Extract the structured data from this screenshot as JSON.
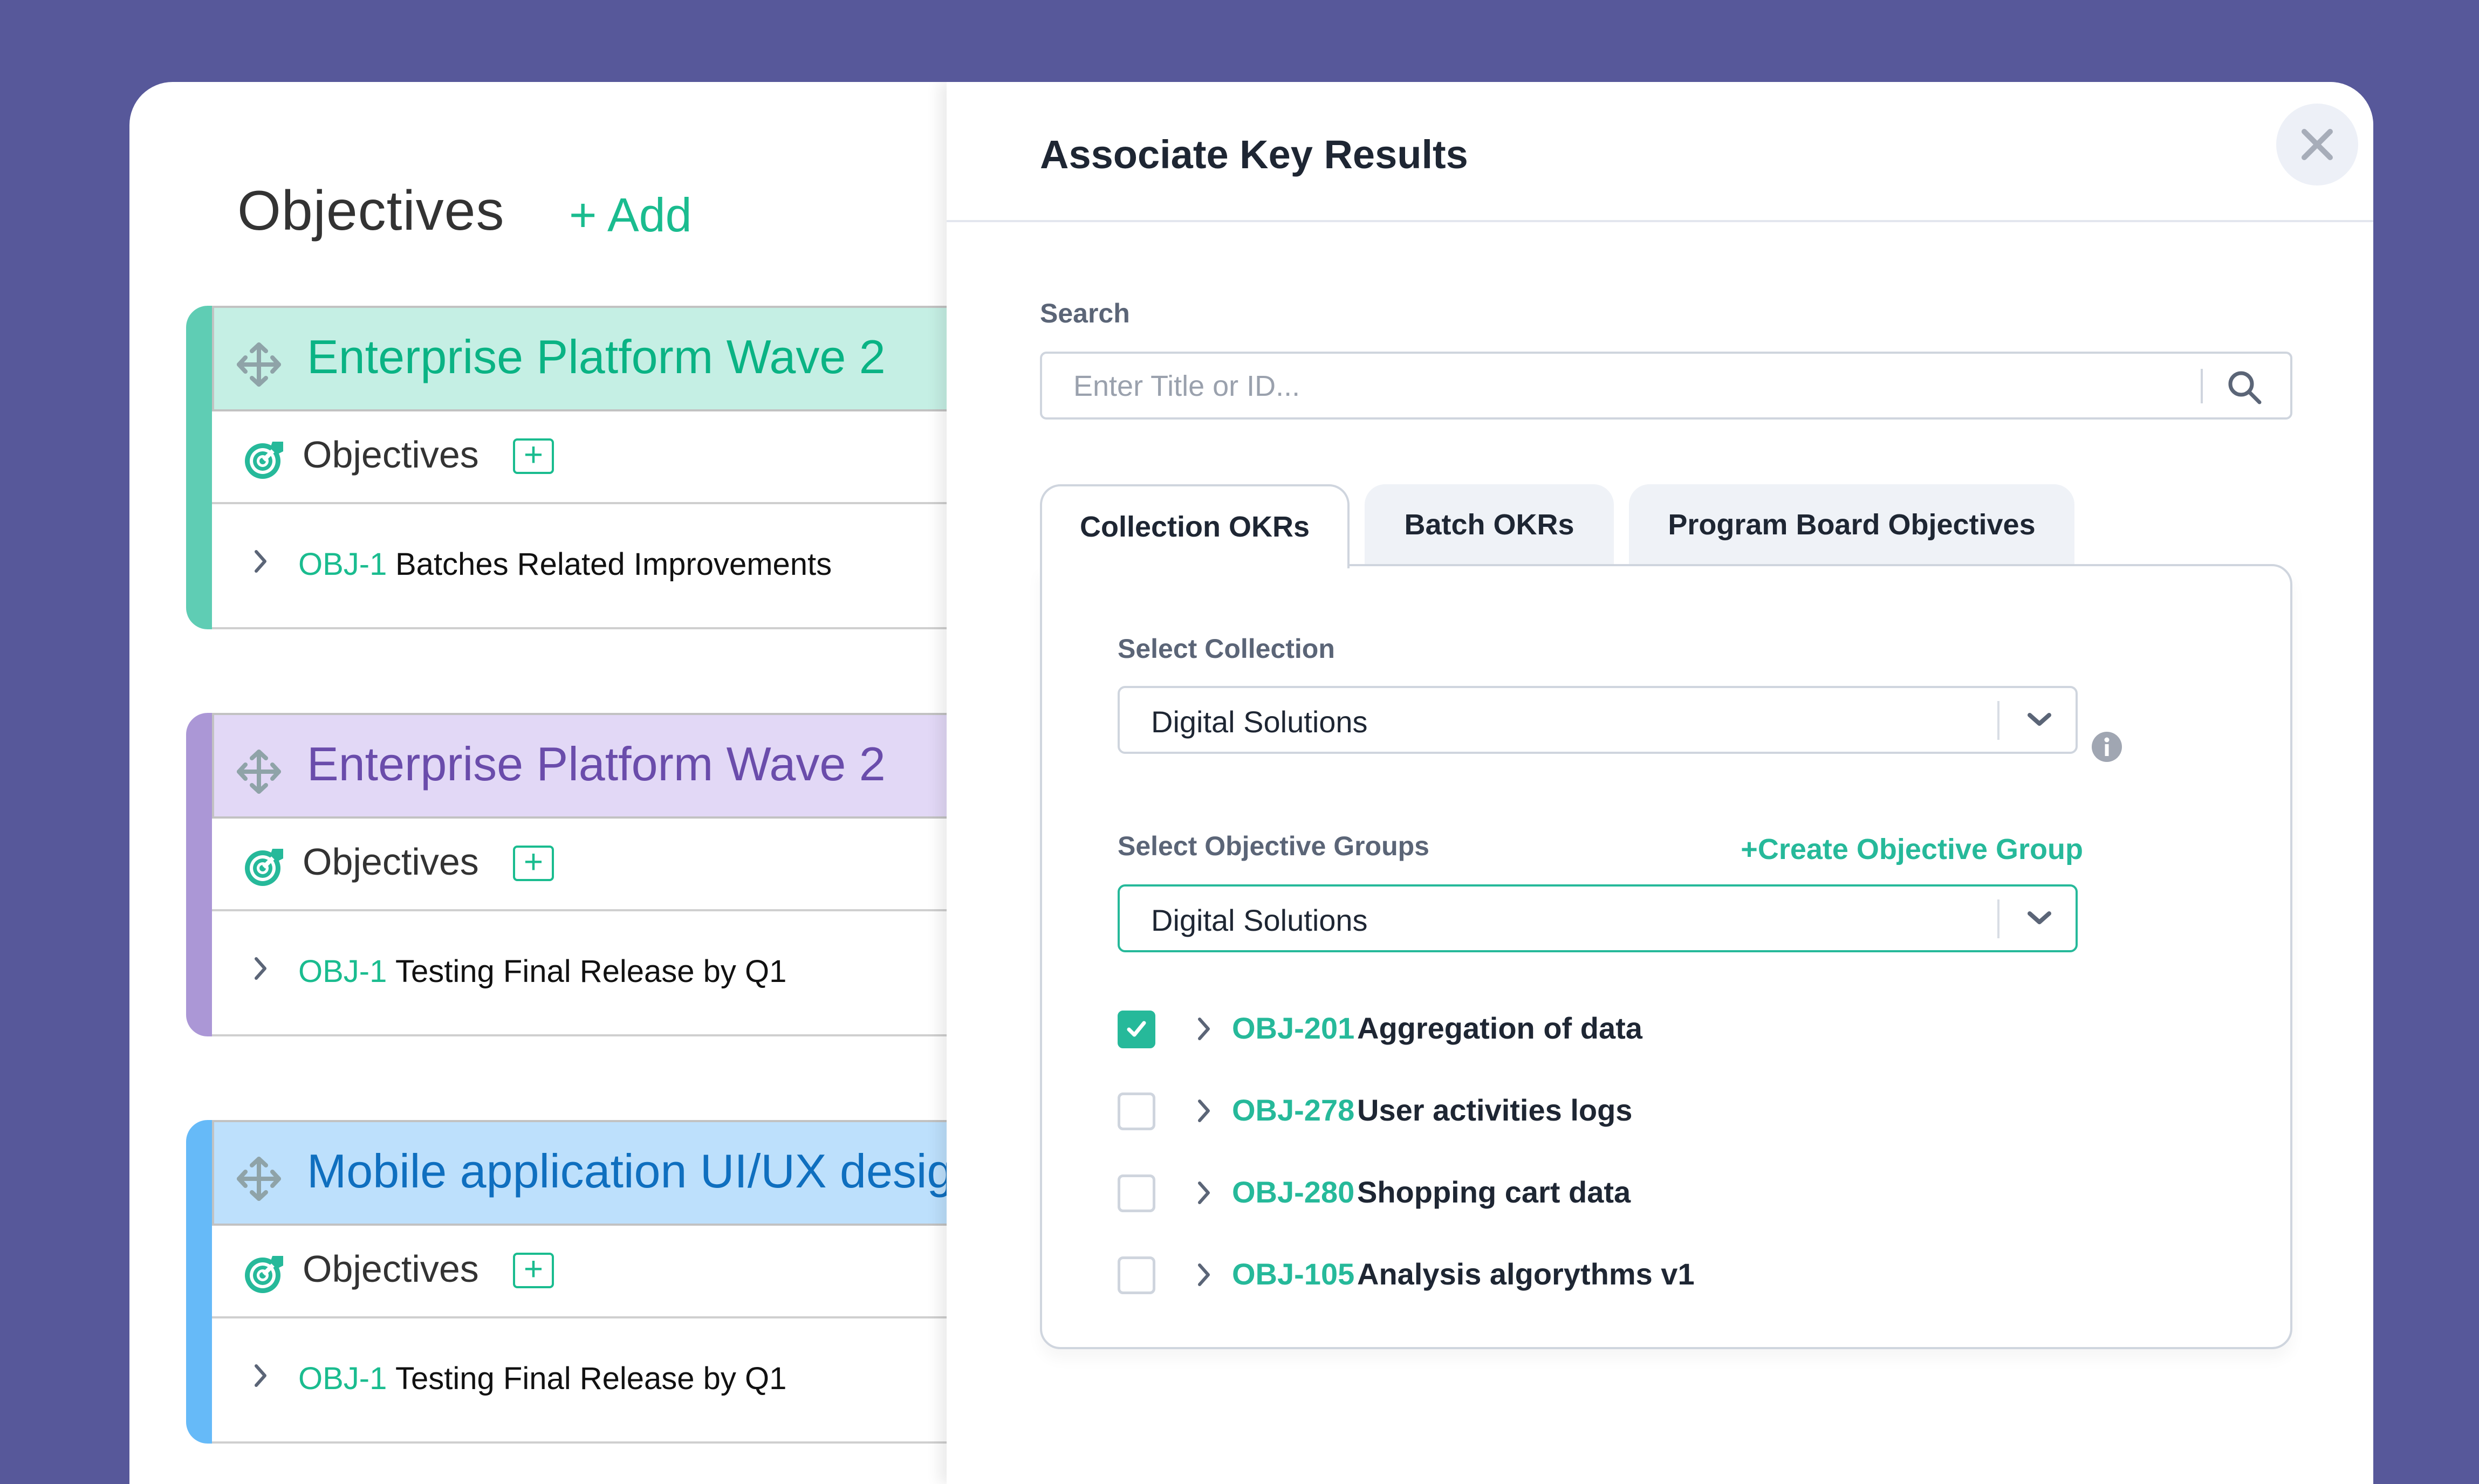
{
  "left": {
    "title": "Objectives",
    "add_label": "+ Add",
    "groups": [
      {
        "title": "Enterprise Platform Wave 2",
        "bar_color": "#5fcdb4",
        "head_bg": "#c5efe4",
        "title_color": "#0ab384",
        "section_label": "Objectives",
        "add_icon": "+",
        "item": {
          "id": "OBJ-1",
          "title": "Batches Related Improvements"
        }
      },
      {
        "title": "Enterprise Platform Wave 2",
        "bar_color": "#ab97d6",
        "head_bg": "#e2d8f6",
        "title_color": "#6a4cab",
        "section_label": "Objectives",
        "add_icon": "+",
        "item": {
          "id": "OBJ-1",
          "title": "Testing Final Release by Q1"
        }
      },
      {
        "title": "Mobile application UI/UX design",
        "bar_color": "#66baf8",
        "head_bg": "#bde0fc",
        "title_color": "#0f6fbf",
        "section_label": "Objectives",
        "add_icon": "+",
        "item": {
          "id": "OBJ-1",
          "title": "Testing Final Release by Q1"
        }
      }
    ]
  },
  "panel": {
    "title": "Associate Key Results",
    "close_icon": "close-icon",
    "search": {
      "label": "Search",
      "placeholder": "Enter Title or ID...",
      "value": ""
    },
    "tabs": [
      {
        "label": "Collection OKRs",
        "active": true
      },
      {
        "label": "Batch OKRs",
        "active": false
      },
      {
        "label": "Program Board Objectives",
        "active": false
      }
    ],
    "collection": {
      "label": "Select Collection",
      "value": "Digital Solutions"
    },
    "objective_groups": {
      "label": "Select Objective Groups",
      "create_label": "+Create Objective Group",
      "value": "Digital Solutions"
    },
    "results": [
      {
        "id": "OBJ-201",
        "title": "Aggregation of data",
        "checked": true
      },
      {
        "id": "OBJ-278",
        "title": "User activities logs",
        "checked": false
      },
      {
        "id": "OBJ-280",
        "title": "Shopping cart data",
        "checked": false
      },
      {
        "id": "OBJ-105",
        "title": "Analysis algorythms v1",
        "checked": false
      }
    ]
  },
  "colors": {
    "background": "#57589a",
    "accent": "#26b99a",
    "text_dark": "#1e2633",
    "label_gray": "#5b6577"
  }
}
